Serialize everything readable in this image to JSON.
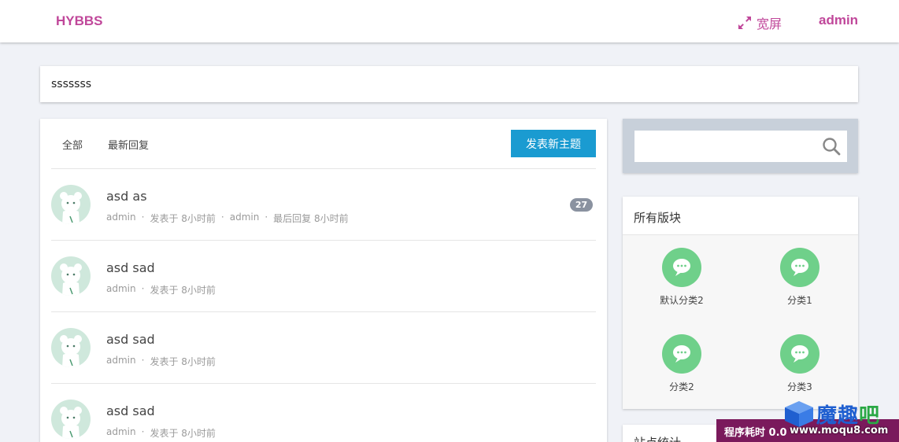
{
  "header": {
    "brand": "HYBBS",
    "wide_label": "宽屏",
    "user": "admin"
  },
  "notice": {
    "text": "sssssss"
  },
  "thread_list": {
    "tabs": [
      {
        "label": "全部"
      },
      {
        "label": "最新回复"
      }
    ],
    "new_topic_label": "发表新主题",
    "threads": [
      {
        "title": "asd as",
        "author": "admin",
        "posted": "发表于 8小时前",
        "last_user": "admin",
        "last_reply": "最后回复 8小时前",
        "replies": "27"
      },
      {
        "title": "asd sad",
        "author": "admin",
        "posted": "发表于 8小时前"
      },
      {
        "title": "asd sad",
        "author": "admin",
        "posted": "发表于 8小时前"
      },
      {
        "title": "asd sad",
        "author": "admin",
        "posted": "发表于 8小时前"
      }
    ]
  },
  "search": {
    "value": ""
  },
  "boards": {
    "title": "所有版块",
    "items": [
      {
        "label": "默认分类2"
      },
      {
        "label": "分类1"
      },
      {
        "label": "分类2"
      },
      {
        "label": "分类3"
      }
    ]
  },
  "stats": {
    "title": "站点统计"
  },
  "debug": {
    "text": "程序耗时 0.0"
  },
  "watermark": {
    "brand": "魔趣",
    "brand_tail": "吧",
    "url": "www.moqu8.com"
  },
  "colors": {
    "accent": "#c0479a",
    "button": "#1a9bd1",
    "board_icon": "#6fd08a",
    "badge": "#8a92a0"
  },
  "icons": {
    "wide": "expand-arrows-icon",
    "search": "search-icon",
    "board": "chat-bubble-icon",
    "avatar": "bear-avatar-icon"
  }
}
